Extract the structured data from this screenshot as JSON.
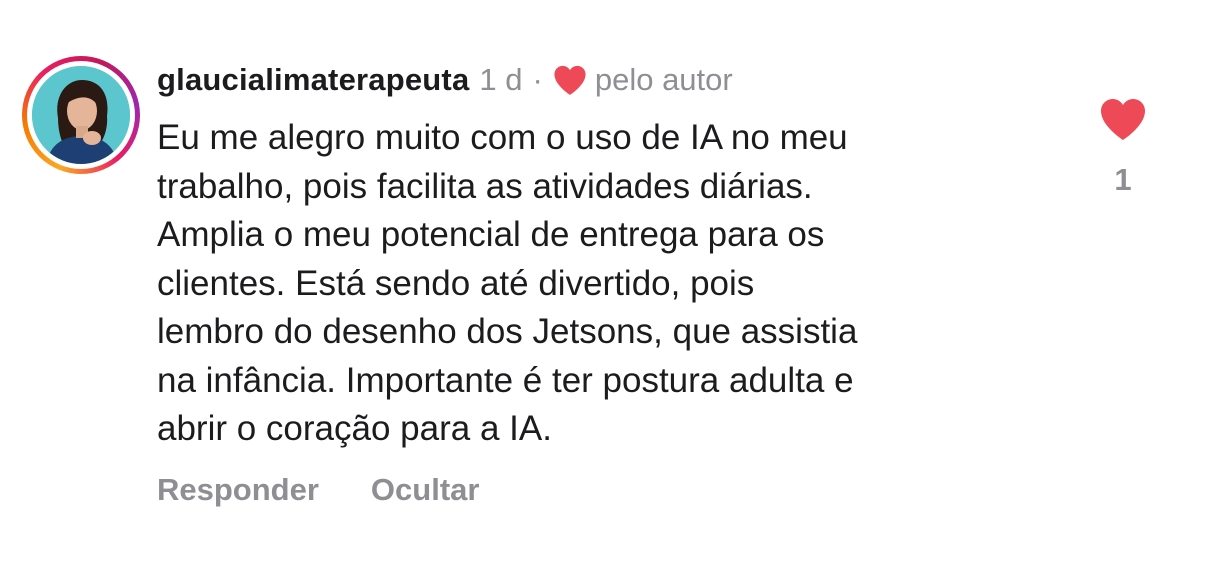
{
  "comment": {
    "username": "glaucialimaterapeuta",
    "time": "1 d",
    "separator": "·",
    "liked_by_author": "pelo autor",
    "lines": [
      "Eu me alegro muito com o uso de IA no meu",
      "trabalho, pois facilita as atividades diárias.",
      "Amplia o meu potencial de entrega para os",
      "clientes. Está sendo até divertido, pois",
      "lembro do desenho dos Jetsons, que assistia",
      "na infância. Importante é ter postura adulta e",
      "abrir o coração para a IA."
    ],
    "like_count": "1"
  },
  "actions": {
    "reply_label": "Responder",
    "hide_label": "Ocultar"
  },
  "icons": {
    "author_heart": "heart-icon",
    "like": "heart-icon"
  },
  "colors": {
    "heart": "#ed4956",
    "muted_text": "#8e8e93",
    "primary_text": "#1c1c1e",
    "avatar_background": "#5cc6cf"
  }
}
